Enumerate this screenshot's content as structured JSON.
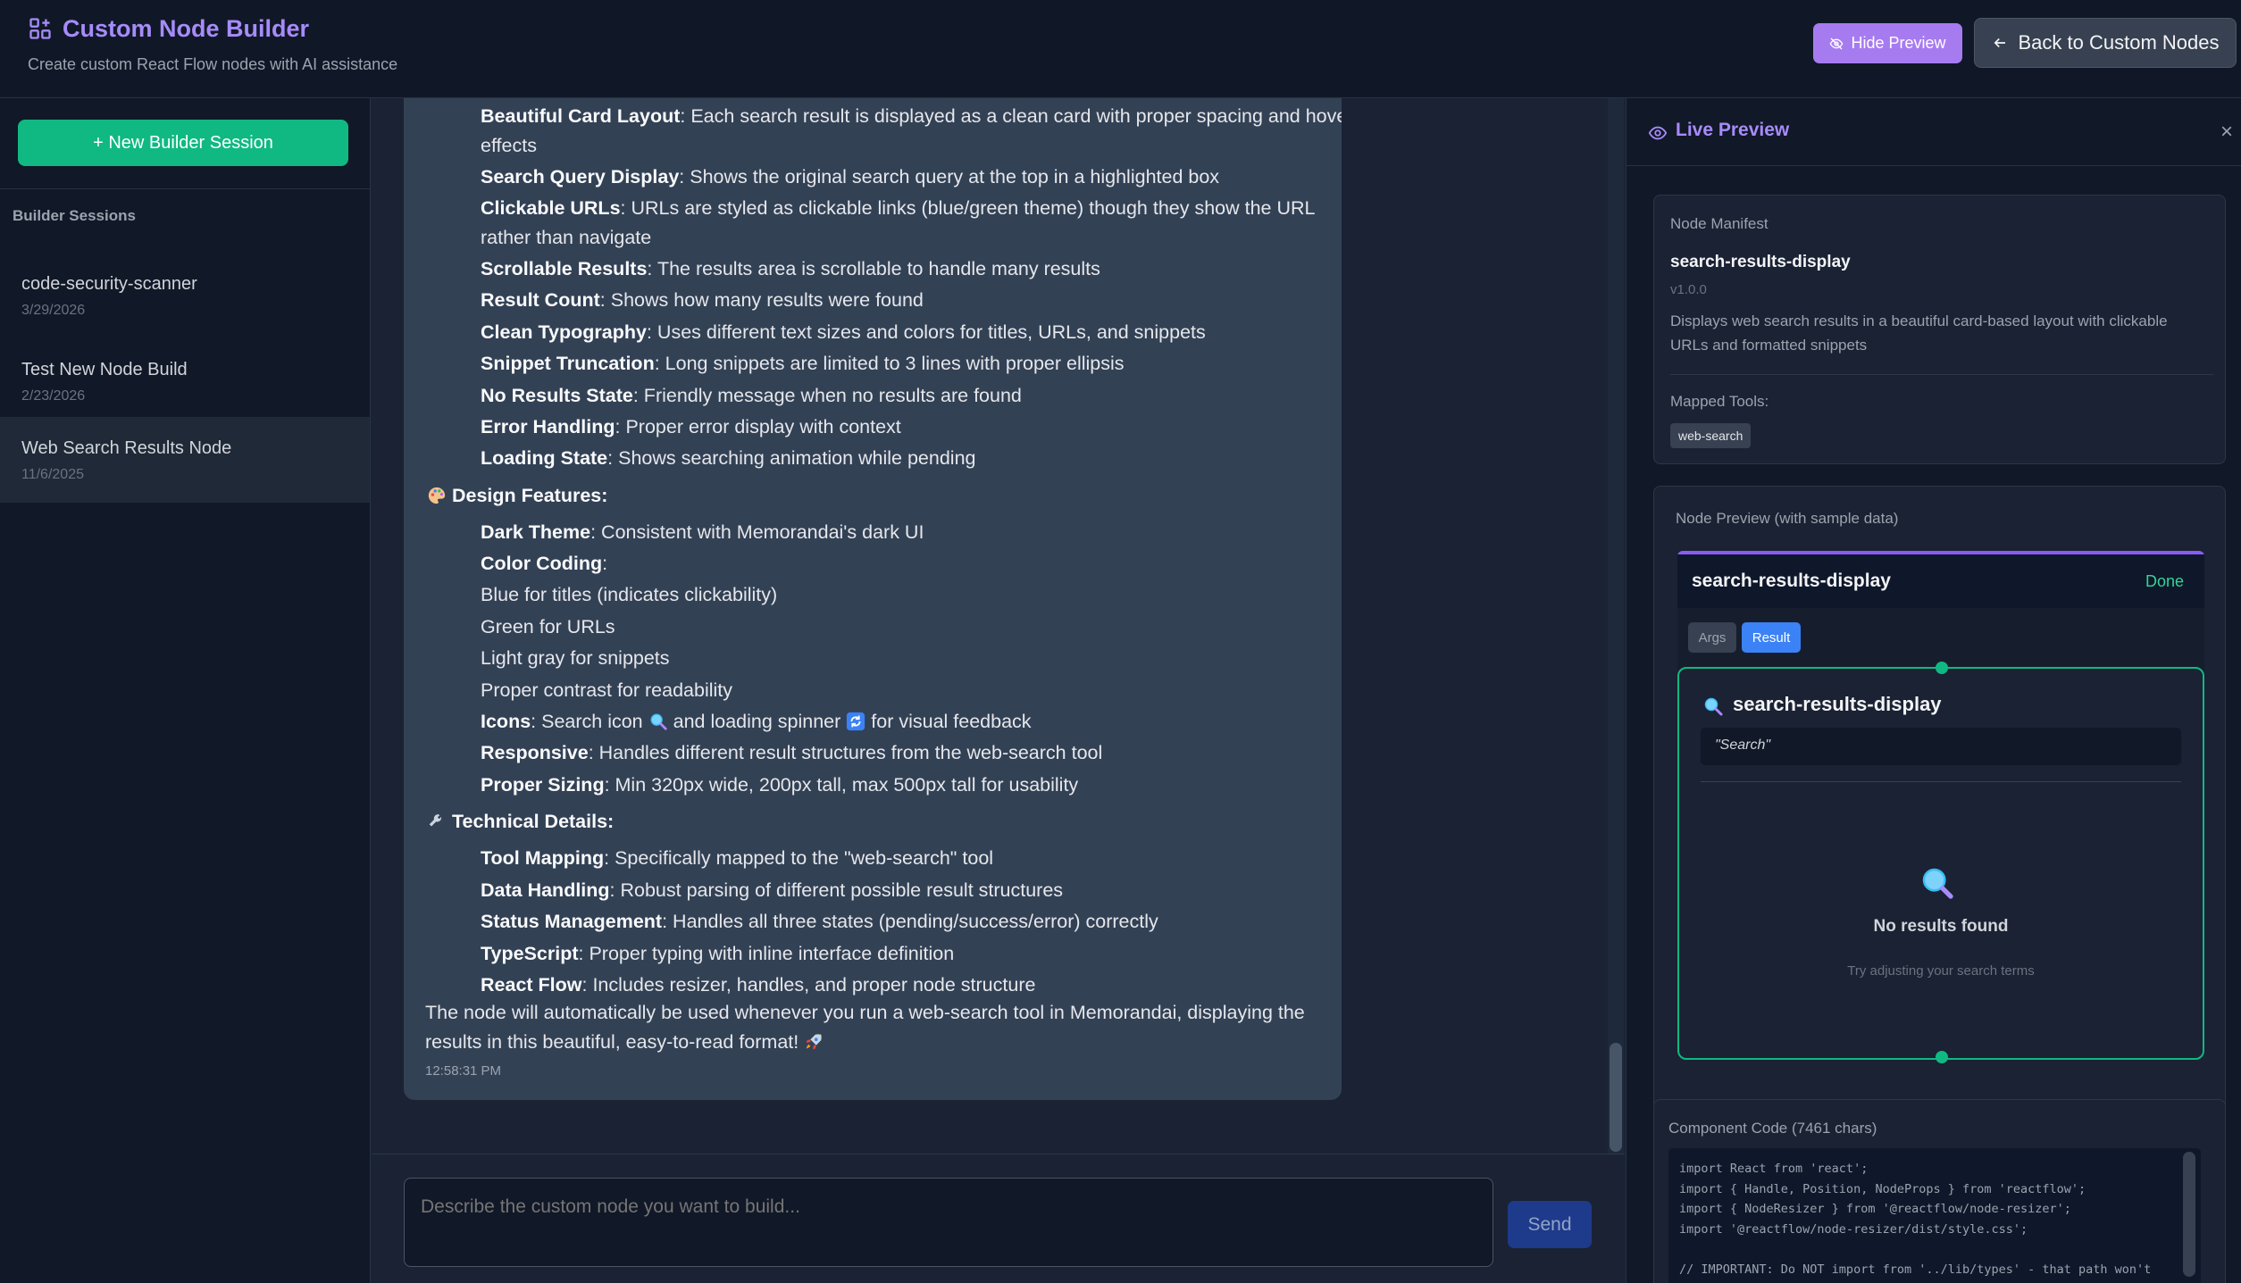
{
  "header": {
    "title": "Custom Node Builder",
    "subtitle": "Create custom React Flow nodes with AI assistance",
    "hide_preview_label": "Hide Preview",
    "back_label": "Back to Custom Nodes",
    "accent_color": "#a78bfa"
  },
  "sidebar": {
    "new_session_label": "+ New Builder Session",
    "heading": "Builder Sessions",
    "sessions": [
      {
        "name": "code-security-scanner",
        "date": "3/29/2026",
        "active": false
      },
      {
        "name": "Test New Node Build",
        "date": "2/23/2026",
        "active": false
      },
      {
        "name": "Web Search Results Node",
        "date": "11/6/2025",
        "active": true
      }
    ]
  },
  "chat": {
    "items_group1": [
      {
        "bold": "Beautiful Card Layout",
        "rest": ": Each search result is displayed as a clean card with proper spacing and hover"
      },
      {
        "bold": "",
        "rest": "effects"
      },
      {
        "bold": "Search Query Display",
        "rest": ": Shows the original search query at the top in a highlighted box"
      },
      {
        "bold": "Clickable URLs",
        "rest": ": URLs are styled as clickable links (blue/green theme) though they show the URL"
      },
      {
        "bold": "",
        "rest": "rather than navigate"
      },
      {
        "bold": "Scrollable Results",
        "rest": ": The results area is scrollable to handle many results"
      },
      {
        "bold": "Result Count",
        "rest": ": Shows how many results were found"
      },
      {
        "bold": "Clean Typography",
        "rest": ": Uses different text sizes and colors for titles, URLs, and snippets"
      },
      {
        "bold": "Snippet Truncation",
        "rest": ": Long snippets are limited to 3 lines with proper ellipsis"
      },
      {
        "bold": "No Results State",
        "rest": ": Friendly message when no results are found"
      },
      {
        "bold": "Error Handling",
        "rest": ": Proper error display with context"
      },
      {
        "bold": "Loading State",
        "rest": ": Shows searching animation while pending"
      }
    ],
    "design_heading": "Design Features:",
    "items_group2": [
      {
        "bold": "Dark Theme",
        "rest": ": Consistent with Memorandai's dark UI"
      },
      {
        "bold": "Color Coding",
        "rest": ":"
      },
      {
        "bold": "",
        "rest": "Blue for titles (indicates clickability)"
      },
      {
        "bold": "",
        "rest": "Green for URLs"
      },
      {
        "bold": "",
        "rest": "Light gray for snippets"
      },
      {
        "bold": "",
        "rest": "Proper contrast for readability"
      }
    ],
    "icons_line": {
      "bold": "Icons",
      "a": ": Search icon",
      "b": "and loading spinner",
      "c": "for visual feedback"
    },
    "items_group3": [
      {
        "bold": "Responsive",
        "rest": ": Handles different result structures from the web-search tool"
      },
      {
        "bold": "Proper Sizing",
        "rest": ": Min 320px wide, 200px tall, max 500px tall for usability"
      }
    ],
    "tech_heading": "Technical Details:",
    "items_group4": [
      {
        "bold": "Tool Mapping",
        "rest": ": Specifically mapped to the \"web-search\" tool"
      },
      {
        "bold": "Data Handling",
        "rest": ": Robust parsing of different possible result structures"
      },
      {
        "bold": "Status Management",
        "rest": ": Handles all three states (pending/success/error) correctly"
      },
      {
        "bold": "TypeScript",
        "rest": ": Proper typing with inline interface definition"
      },
      {
        "bold": "React Flow",
        "rest": ": Includes resizer, handles, and proper node structure"
      }
    ],
    "closing_line1": "The node will automatically be used whenever you run a web-search tool in Memorandai, displaying the",
    "closing_line2": "results in this beautiful, easy-to-read format!",
    "timestamp": "12:58:31 PM",
    "input_placeholder": "Describe the custom node you want to build...",
    "send_label": "Send"
  },
  "preview": {
    "title": "Live Preview",
    "close_glyph": "×",
    "manifest": {
      "label": "Node Manifest",
      "name": "search-results-display",
      "version": "v1.0.0",
      "description": "Displays web search results in a beautiful card-based layout with clickable URLs and formatted snippets",
      "tools_label": "Mapped Tools:",
      "tools": [
        "web-search"
      ]
    },
    "node_preview": {
      "label": "Node Preview (with sample data)",
      "node_title": "search-results-display",
      "status": "Done",
      "tabs": [
        "Args",
        "Result"
      ],
      "selected_tab": "Result",
      "result_title": "search-results-display",
      "query": "\"Search\"",
      "empty_title": "No results found",
      "empty_hint": "Try adjusting your search terms"
    },
    "code": {
      "label": "Component Code (7461 chars)",
      "lines": [
        "import React from 'react';",
        "import { Handle, Position, NodeProps } from 'reactflow';",
        "import { NodeResizer } from '@reactflow/node-resizer';",
        "import '@reactflow/node-resizer/dist/style.css';",
        "",
        "// IMPORTANT: Do NOT import from '../lib/types' - that path won't"
      ]
    }
  }
}
